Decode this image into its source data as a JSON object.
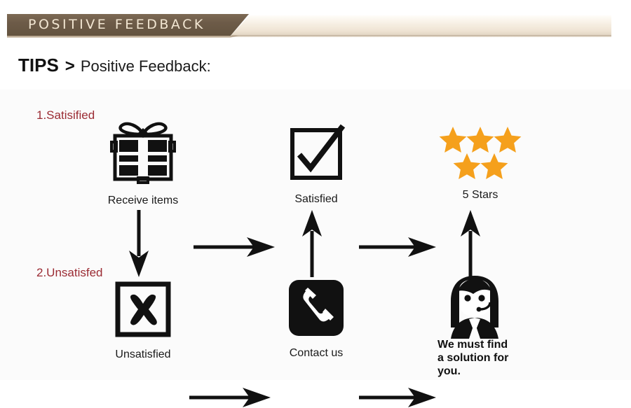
{
  "banner": {
    "title": "POSITIVE  FEEDBACK",
    "dark_color": "#6d5b48",
    "cream_color": "#f2e9dc"
  },
  "heading": {
    "tips": "TIPS",
    "separator": ">",
    "subject": "Positive Feedback:"
  },
  "colors": {
    "step_label": "#9b2b33",
    "star": "#f5a01c",
    "icon": "#111111",
    "background": "#fbfbfb"
  },
  "diagram": {
    "steps": [
      {
        "id": "step-1",
        "label": "1.Satisified"
      },
      {
        "id": "step-2",
        "label": "2.Unsatisfed"
      }
    ],
    "nodes": [
      {
        "id": "receive-items",
        "icon": "gift-box-icon",
        "label": "Receive items"
      },
      {
        "id": "satisfied",
        "icon": "check-box-icon",
        "label": "Satisfied"
      },
      {
        "id": "five-stars",
        "icon": "five-stars-icon",
        "label": "5 Stars"
      },
      {
        "id": "unsatisfied",
        "icon": "x-box-icon",
        "label": "Unsatisfied"
      },
      {
        "id": "contact-us",
        "icon": "telephone-icon",
        "label": "Contact us"
      },
      {
        "id": "support-agent",
        "icon": "support-agent-icon",
        "label": "We must find\na solution for\nyou."
      }
    ],
    "stars_count": 5,
    "arrows": [
      {
        "id": "arrow-receive-to-satisfied",
        "direction": "right"
      },
      {
        "id": "arrow-satisfied-to-stars",
        "direction": "right"
      },
      {
        "id": "arrow-receive-to-unsatisfied",
        "direction": "down"
      },
      {
        "id": "arrow-unsatisfied-to-contact",
        "direction": "right"
      },
      {
        "id": "arrow-contact-to-satisfied",
        "direction": "up"
      },
      {
        "id": "arrow-contact-to-agent",
        "direction": "right"
      },
      {
        "id": "arrow-agent-to-stars",
        "direction": "up"
      }
    ]
  }
}
